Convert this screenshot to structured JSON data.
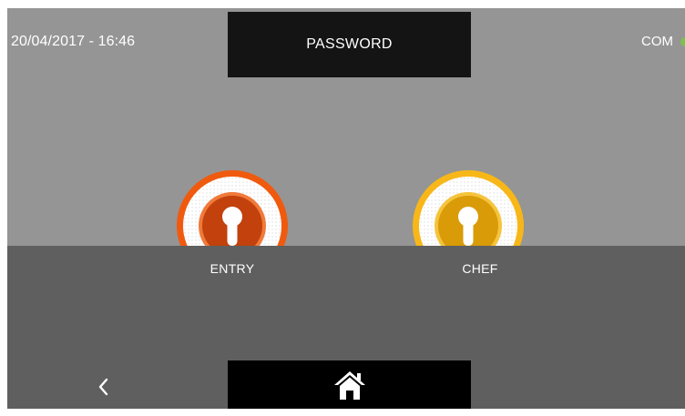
{
  "header": {
    "datetime": "20/04/2017 - 16:46",
    "title": "PASSWORD",
    "status_label": "COM",
    "status_color": "#7cc24a"
  },
  "doors": [
    {
      "label": "ENTRY",
      "icon": "keyhole-icon",
      "ring_color": "#f05a0f",
      "core_color": "#c2410c"
    },
    {
      "label": "CHEF",
      "icon": "keyhole-icon",
      "ring_color": "#f7b718",
      "core_color": "#d99b07"
    }
  ],
  "footer": {
    "back_icon": "chevron-left-icon",
    "home_icon": "home-icon"
  },
  "colors": {
    "upper_background": "#959595",
    "lower_background": "#5f5f5f",
    "panel_background": "#141414"
  }
}
